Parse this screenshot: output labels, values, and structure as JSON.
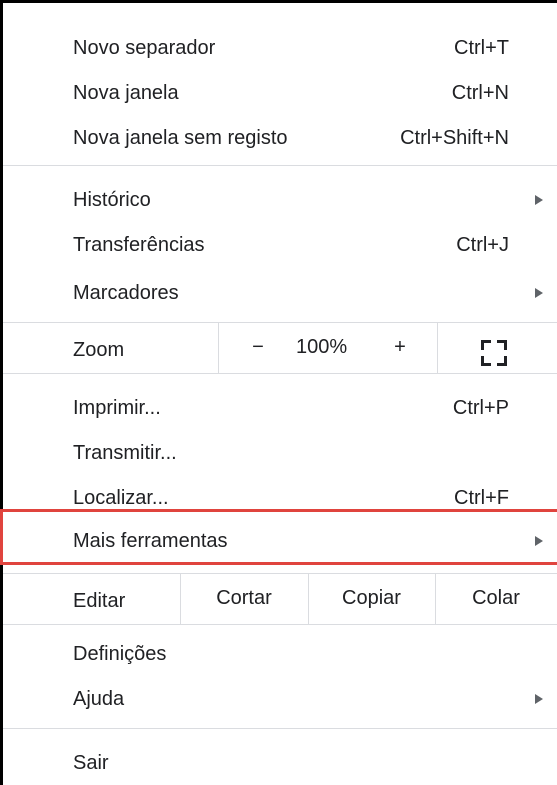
{
  "menu": {
    "new_tab": {
      "label": "Novo separador",
      "shortcut": "Ctrl+T"
    },
    "new_window": {
      "label": "Nova janela",
      "shortcut": "Ctrl+N"
    },
    "incognito": {
      "label": "Nova janela sem registo",
      "shortcut": "Ctrl+Shift+N"
    },
    "history": {
      "label": "Histórico"
    },
    "downloads": {
      "label": "Transferências",
      "shortcut": "Ctrl+J"
    },
    "bookmarks": {
      "label": "Marcadores"
    },
    "zoom": {
      "label": "Zoom",
      "minus": "−",
      "value": "100%",
      "plus": "+"
    },
    "print": {
      "label": "Imprimir...",
      "shortcut": "Ctrl+P"
    },
    "cast": {
      "label": "Transmitir..."
    },
    "find": {
      "label": "Localizar...",
      "shortcut": "Ctrl+F"
    },
    "more_tools": {
      "label": "Mais ferramentas"
    },
    "edit": {
      "label": "Editar",
      "cut": "Cortar",
      "copy": "Copiar",
      "paste": "Colar"
    },
    "settings": {
      "label": "Definições"
    },
    "help": {
      "label": "Ajuda"
    },
    "exit": {
      "label": "Sair"
    }
  },
  "icons": {
    "submenu": "chevron-right-icon",
    "fullscreen": "fullscreen-icon"
  },
  "colors": {
    "highlight": "#e0443e",
    "separator": "#dadce0",
    "text": "#202124"
  }
}
